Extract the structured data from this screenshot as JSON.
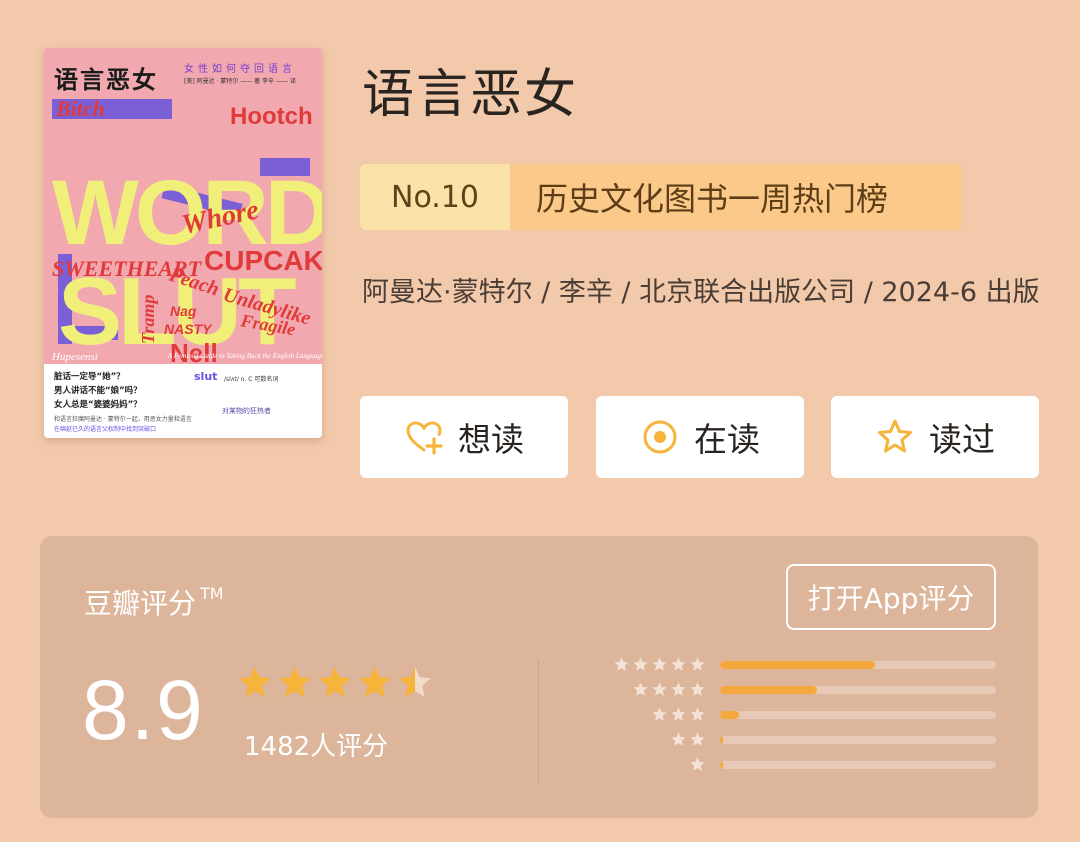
{
  "colors": {
    "background": "#f3c9ab",
    "panel": "#dcb59b",
    "accent": "#f4a73c",
    "star": "#f6b43a"
  },
  "cover": {
    "title": "语言恶女",
    "subtitle": "女性如何夺回语言",
    "meta": "[美] 阿曼达 · 蒙特尔 —— 著   李辛 —— 译",
    "words": [
      "Bitch",
      "Hootch",
      "WORDS",
      "Whore",
      "CUPCAKE",
      "SWEETHEART",
      "Peach",
      "Hupesensi",
      "Unladylike",
      "Nag",
      "NASTY",
      "Fragile",
      "Tramp",
      "SLUT",
      "Nell"
    ],
    "english_subtitle": "A Feminist Guide to Taking Back the English Language",
    "question_lines": [
      "脏话一定导“她”？",
      "男人讲话不能“娘”吗？",
      "女人总是“婆婆妈妈”？"
    ],
    "bottom_lines": [
      "和语言狂魔阿曼达 · 蒙特尔一起，用恶女力量和语言",
      "在绵延已久的语言父权制中找到突破口"
    ],
    "slut": "slut",
    "definition": "/slʌt/ n. C 可数名词",
    "tag": "对某物的狂热者"
  },
  "book": {
    "title": "语言恶女",
    "rank_no": "No.10",
    "rank_name": "历史文化图书一周热门榜",
    "byline": "阿曼达·蒙特尔 / 李辛 / 北京联合出版公司 / 2024-6 出版"
  },
  "actions": {
    "want": {
      "label": "想读",
      "icon": "heart-plus-icon"
    },
    "reading": {
      "label": "在读",
      "icon": "target-icon"
    },
    "read": {
      "label": "读过",
      "icon": "star-outline-icon"
    }
  },
  "rating": {
    "label": "豆瓣评分",
    "trademark": "TM",
    "open_app": "打开App评分",
    "score": "8.9",
    "stars": 4.5,
    "count": "1482人评分",
    "distribution": [
      {
        "stars": 5,
        "fraction": 0.56
      },
      {
        "stars": 4,
        "fraction": 0.35
      },
      {
        "stars": 3,
        "fraction": 0.07
      },
      {
        "stars": 2,
        "fraction": 0.01
      },
      {
        "stars": 1,
        "fraction": 0.01
      }
    ]
  }
}
